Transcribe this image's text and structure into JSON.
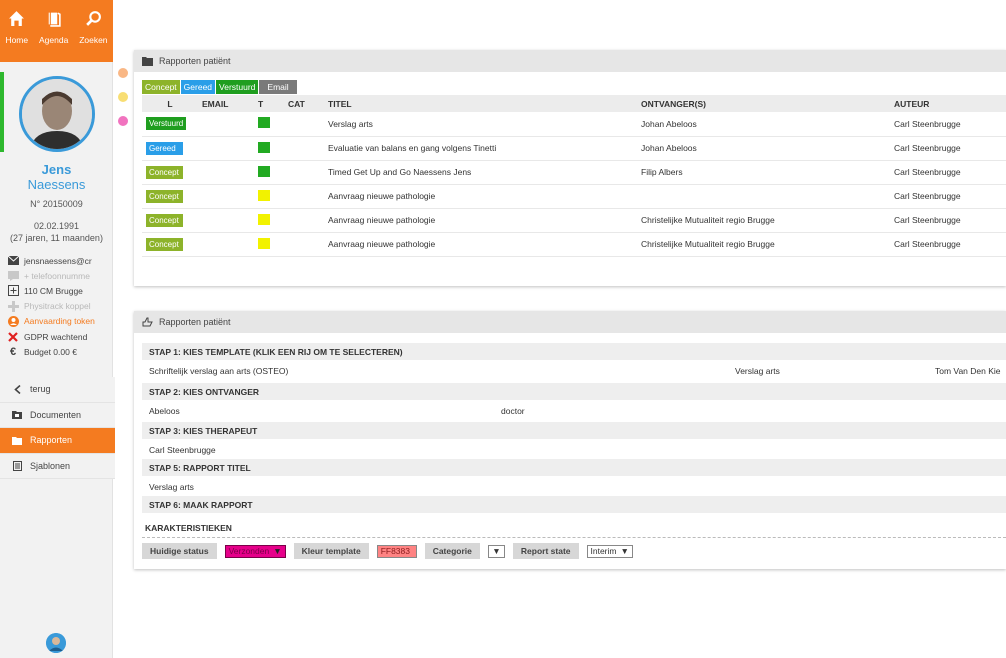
{
  "nav": {
    "home": "Home",
    "agenda": "Agenda",
    "zoeken": "Zoeken"
  },
  "patient": {
    "first_name": "Jens",
    "last_name": "Naessens",
    "number": "N° 20150009",
    "dob": "02.02.1991",
    "age": "(27 jaren, 11 maanden)"
  },
  "info": [
    {
      "icon": "mail-icon",
      "text": "jensnaessens@cr"
    },
    {
      "icon": "phone-icon",
      "text": "+ telefoonnumme"
    },
    {
      "icon": "address-icon",
      "text": "110 CM Brugge"
    },
    {
      "icon": "plus-icon",
      "text": "Physitrack koppel"
    },
    {
      "icon": "user-icon",
      "text": "Aanvaarding token"
    },
    {
      "icon": "cross-icon",
      "text": "GDPR wachtend"
    },
    {
      "icon": "euro-icon",
      "text": "Budget  0.00 €"
    }
  ],
  "menu": {
    "terug": "terug",
    "documenten": "Documenten",
    "rapporten": "Rapporten",
    "sjablonen": "Sjablonen"
  },
  "panel1": {
    "title": "Rapporten patiënt",
    "tabs": [
      "Concept",
      "Gereed",
      "Verstuurd",
      "Email"
    ],
    "columns": [
      "L",
      "EMAIL",
      "T",
      "CAT",
      "TITEL",
      "ONTVANGER(S)",
      "AUTEUR"
    ],
    "rows": [
      {
        "status": "Verstuurd",
        "color": "green",
        "title": "Verslag arts",
        "recipient": "Johan Abeloos",
        "author": "Carl Steenbrugge"
      },
      {
        "status": "Gereed",
        "color": "green",
        "title": "Evaluatie van balans en gang volgens Tinetti",
        "recipient": "Johan Abeloos",
        "author": "Carl Steenbrugge"
      },
      {
        "status": "Concept",
        "color": "green",
        "title": "Timed Get Up and Go Naessens Jens",
        "recipient": "Filip Albers",
        "author": "Carl Steenbrugge"
      },
      {
        "status": "Concept",
        "color": "yellow",
        "title": "Aanvraag nieuwe pathologie",
        "recipient": "",
        "author": "Carl Steenbrugge"
      },
      {
        "status": "Concept",
        "color": "yellow",
        "title": "Aanvraag nieuwe pathologie",
        "recipient": "Christelijke Mutualiteit regio Brugge",
        "author": "Carl Steenbrugge"
      },
      {
        "status": "Concept",
        "color": "yellow",
        "title": "Aanvraag nieuwe pathologie",
        "recipient": "Christelijke Mutualiteit regio Brugge",
        "author": "Carl Steenbrugge"
      }
    ]
  },
  "panel2": {
    "title": "Rapporten patiënt",
    "step1": "STAP 1: KIES TEMPLATE (KLIK EEN RIJ OM TE SELECTEREN)",
    "step1_row": {
      "name": "Schriftelijk verslag aan arts (OSTEO)",
      "type": "Verslag arts",
      "author": "Tom Van Den Kie"
    },
    "step2": "STAP 2: KIES ONTVANGER",
    "step2_row": {
      "name": "Abeloos",
      "role": "doctor"
    },
    "step3": "STAP 3: KIES THERAPEUT",
    "step3_row": "Carl Steenbrugge",
    "step5": "STAP 5: RAPPORT TITEL",
    "step5_row": "Verslag arts",
    "step6": "STAP 6: MAAK RAPPORT",
    "karakteristieken": "KARAKTERISTIEKEN",
    "huidige_status_label": "Huidige status",
    "huidige_status_value": "Verzonden",
    "kleur_template_label": "Kleur template",
    "kleur_template_value": "FF8383",
    "categorie_label": "Categorie",
    "report_state_label": "Report state",
    "report_state_value": "Interim"
  },
  "colors": {
    "orange": "#f47b20",
    "concept": "#8db32a",
    "gereed": "#2a9ee8",
    "verstuurd": "#1f9e1f",
    "email": "#7a7a7a",
    "green_sq": "#22aa22",
    "yellow_sq": "#f2f200",
    "status_pink": "#e6008a",
    "template_pink": "#ff8383"
  }
}
